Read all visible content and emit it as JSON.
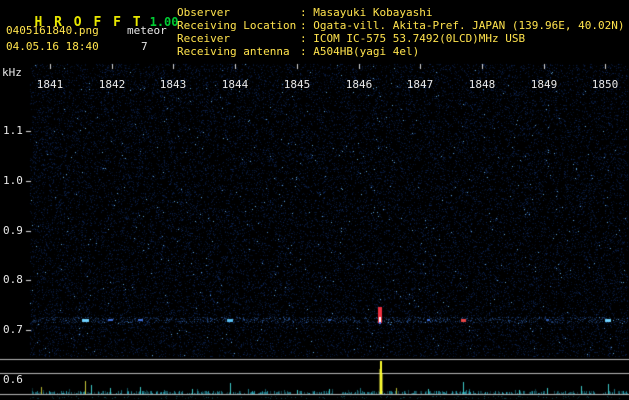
{
  "header": {
    "logo_letters": "H R O F F T",
    "version": "1.00",
    "filename": "0405161840.png",
    "mode_label": "meteor",
    "datetime": "04.05.16 18:40",
    "echo_count": "7",
    "info_rows": [
      {
        "label": "Observer",
        "value": ": Masayuki Kobayashi"
      },
      {
        "label": "Receiving Location",
        "value": ": Ogata-vill. Akita-Pref. JAPAN (139.96E, 40.02N)"
      },
      {
        "label": "Receiver",
        "value": ": ICOM IC-575 53.7492(0LCD)MHz USB"
      },
      {
        "label": "Receiving antenna",
        "value": ": A504HB(yagi 4el)"
      }
    ]
  },
  "colors": {
    "background": "#000000",
    "header_text": "#ffe34d",
    "logo": "#e8e800",
    "version": "#00cc33",
    "white_text": "#e8e8e8",
    "noise": "#16408c",
    "grid_line": "#b8b8b8",
    "baseline_noise": "#28aabe",
    "strong_echo": "#f03040",
    "strong_spike": "#ffff30"
  },
  "chart_data": {
    "type": "heatmap",
    "title": "HROFFT radio meteor echo spectrogram 0405161840",
    "x_axis": {
      "unit": "time (hhmm)",
      "tick_labels": [
        "1841",
        "1842",
        "1843",
        "1844",
        "1845",
        "1846",
        "1847",
        "1848",
        "1849",
        "1850"
      ]
    },
    "y_axis": {
      "unit": "kHz",
      "tick_labels": [
        "1.1",
        "1.0",
        "0.9",
        "0.8",
        "0.7",
        "0.6"
      ],
      "range_khz": [
        0.6,
        1.15
      ]
    },
    "echo_band_khz": 0.72,
    "echoes": [
      {
        "time": 1841.57,
        "khz": 0.72,
        "width": 7,
        "height": 3,
        "color": "#6fd2ff"
      },
      {
        "time": 1841.97,
        "khz": 0.72,
        "width": 5,
        "height": 2,
        "color": "#3e6fd8"
      },
      {
        "time": 1842.46,
        "khz": 0.72,
        "width": 5,
        "height": 2,
        "color": "#3e6fd8"
      },
      {
        "time": 1843.92,
        "khz": 0.72,
        "width": 6,
        "height": 3,
        "color": "#58bdf0"
      },
      {
        "time": 1845.52,
        "khz": 0.72,
        "width": 3,
        "height": 2,
        "color": "#2d59ad"
      },
      {
        "time": 1846.35,
        "khz": 0.73,
        "width": 4,
        "height": 16,
        "color": "#f03040",
        "core_color": "#ffffff"
      },
      {
        "time": 1847.12,
        "khz": 0.72,
        "width": 3,
        "height": 2,
        "color": "#3e6fd8"
      },
      {
        "time": 1847.7,
        "khz": 0.72,
        "width": 5,
        "height": 3,
        "color": "#e84444"
      },
      {
        "time": 1849.05,
        "khz": 0.72,
        "width": 3,
        "height": 2,
        "color": "#2d59ad"
      },
      {
        "time": 1850.05,
        "khz": 0.72,
        "width": 6,
        "height": 3,
        "color": "#6fd2ff"
      }
    ],
    "amplitude_spikes": [
      {
        "time": 1840.85,
        "height": 7,
        "color": "#b8b830"
      },
      {
        "time": 1841.57,
        "height": 13,
        "color": "#c8c838"
      },
      {
        "time": 1841.66,
        "height": 9,
        "color": "#3cc8c8"
      },
      {
        "time": 1841.97,
        "height": 6,
        "color": "#3cc8c8"
      },
      {
        "time": 1842.46,
        "height": 7,
        "color": "#3cc8c8"
      },
      {
        "time": 1843.3,
        "height": 5,
        "color": "#3cc8c8"
      },
      {
        "time": 1843.92,
        "height": 11,
        "color": "#3cc8c8"
      },
      {
        "time": 1845.0,
        "height": 4,
        "color": "#3cc8c8"
      },
      {
        "time": 1845.52,
        "height": 5,
        "color": "#3cc8c8"
      },
      {
        "time": 1846.35,
        "height": 33,
        "color": "#ffff30"
      },
      {
        "time": 1846.6,
        "height": 6,
        "color": "#b8b830"
      },
      {
        "time": 1847.12,
        "height": 5,
        "color": "#3cc8c8"
      },
      {
        "time": 1847.7,
        "height": 12,
        "color": "#3cc8c8"
      },
      {
        "time": 1848.6,
        "height": 4,
        "color": "#3cc8c8"
      },
      {
        "time": 1849.05,
        "height": 6,
        "color": "#3cc8c8"
      },
      {
        "time": 1849.6,
        "height": 8,
        "color": "#3cc8c8"
      },
      {
        "time": 1850.05,
        "height": 10,
        "color": "#3cc8c8"
      }
    ]
  }
}
